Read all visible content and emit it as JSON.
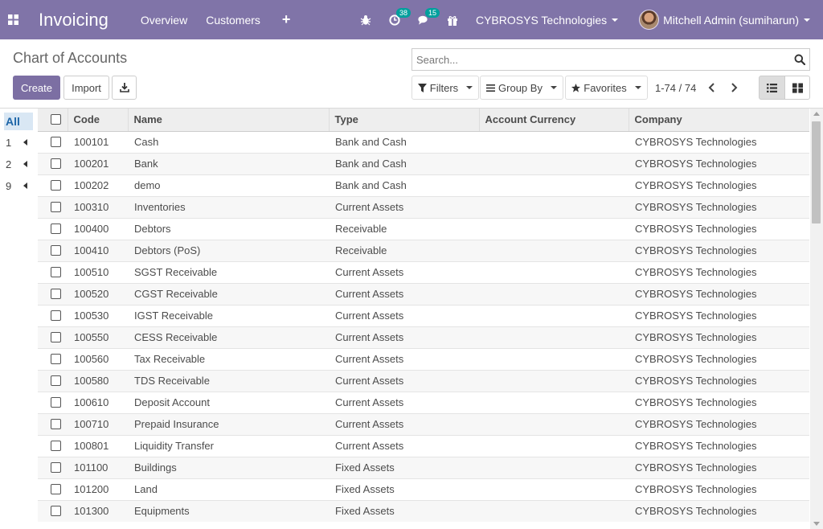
{
  "navbar": {
    "app_name": "Invoicing",
    "menu": [
      "Overview",
      "Customers"
    ],
    "plus_label": "+",
    "activity_count": "38",
    "message_count": "15",
    "company": "CYBROSYS Technologies",
    "user": "Mitchell Admin (sumiharun)",
    "bg_color": "#8074a8"
  },
  "control_panel": {
    "title": "Chart of Accounts",
    "search_placeholder": "Search...",
    "create_label": "Create",
    "import_label": "Import",
    "filters_label": "Filters",
    "group_by_label": "Group By",
    "favorites_label": "Favorites",
    "pager": "1-74 / 74"
  },
  "side_panel": {
    "all_label": "All",
    "groups": [
      "1",
      "2",
      "9"
    ]
  },
  "table": {
    "headers": [
      "Code",
      "Name",
      "Type",
      "Account Currency",
      "Company"
    ],
    "rows": [
      [
        "100101",
        "Cash",
        "Bank and Cash",
        "",
        "CYBROSYS Technologies"
      ],
      [
        "100201",
        "Bank",
        "Bank and Cash",
        "",
        "CYBROSYS Technologies"
      ],
      [
        "100202",
        "demo",
        "Bank and Cash",
        "",
        "CYBROSYS Technologies"
      ],
      [
        "100310",
        "Inventories",
        "Current Assets",
        "",
        "CYBROSYS Technologies"
      ],
      [
        "100400",
        "Debtors",
        "Receivable",
        "",
        "CYBROSYS Technologies"
      ],
      [
        "100410",
        "Debtors (PoS)",
        "Receivable",
        "",
        "CYBROSYS Technologies"
      ],
      [
        "100510",
        "SGST Receivable",
        "Current Assets",
        "",
        "CYBROSYS Technologies"
      ],
      [
        "100520",
        "CGST Receivable",
        "Current Assets",
        "",
        "CYBROSYS Technologies"
      ],
      [
        "100530",
        "IGST Receivable",
        "Current Assets",
        "",
        "CYBROSYS Technologies"
      ],
      [
        "100550",
        "CESS Receivable",
        "Current Assets",
        "",
        "CYBROSYS Technologies"
      ],
      [
        "100560",
        "Tax Receivable",
        "Current Assets",
        "",
        "CYBROSYS Technologies"
      ],
      [
        "100580",
        "TDS Receivable",
        "Current Assets",
        "",
        "CYBROSYS Technologies"
      ],
      [
        "100610",
        "Deposit Account",
        "Current Assets",
        "",
        "CYBROSYS Technologies"
      ],
      [
        "100710",
        "Prepaid Insurance",
        "Current Assets",
        "",
        "CYBROSYS Technologies"
      ],
      [
        "100801",
        "Liquidity Transfer",
        "Current Assets",
        "",
        "CYBROSYS Technologies"
      ],
      [
        "101100",
        "Buildings",
        "Fixed Assets",
        "",
        "CYBROSYS Technologies"
      ],
      [
        "101200",
        "Land",
        "Fixed Assets",
        "",
        "CYBROSYS Technologies"
      ],
      [
        "101300",
        "Equipments",
        "Fixed Assets",
        "",
        "CYBROSYS Technologies"
      ]
    ]
  }
}
